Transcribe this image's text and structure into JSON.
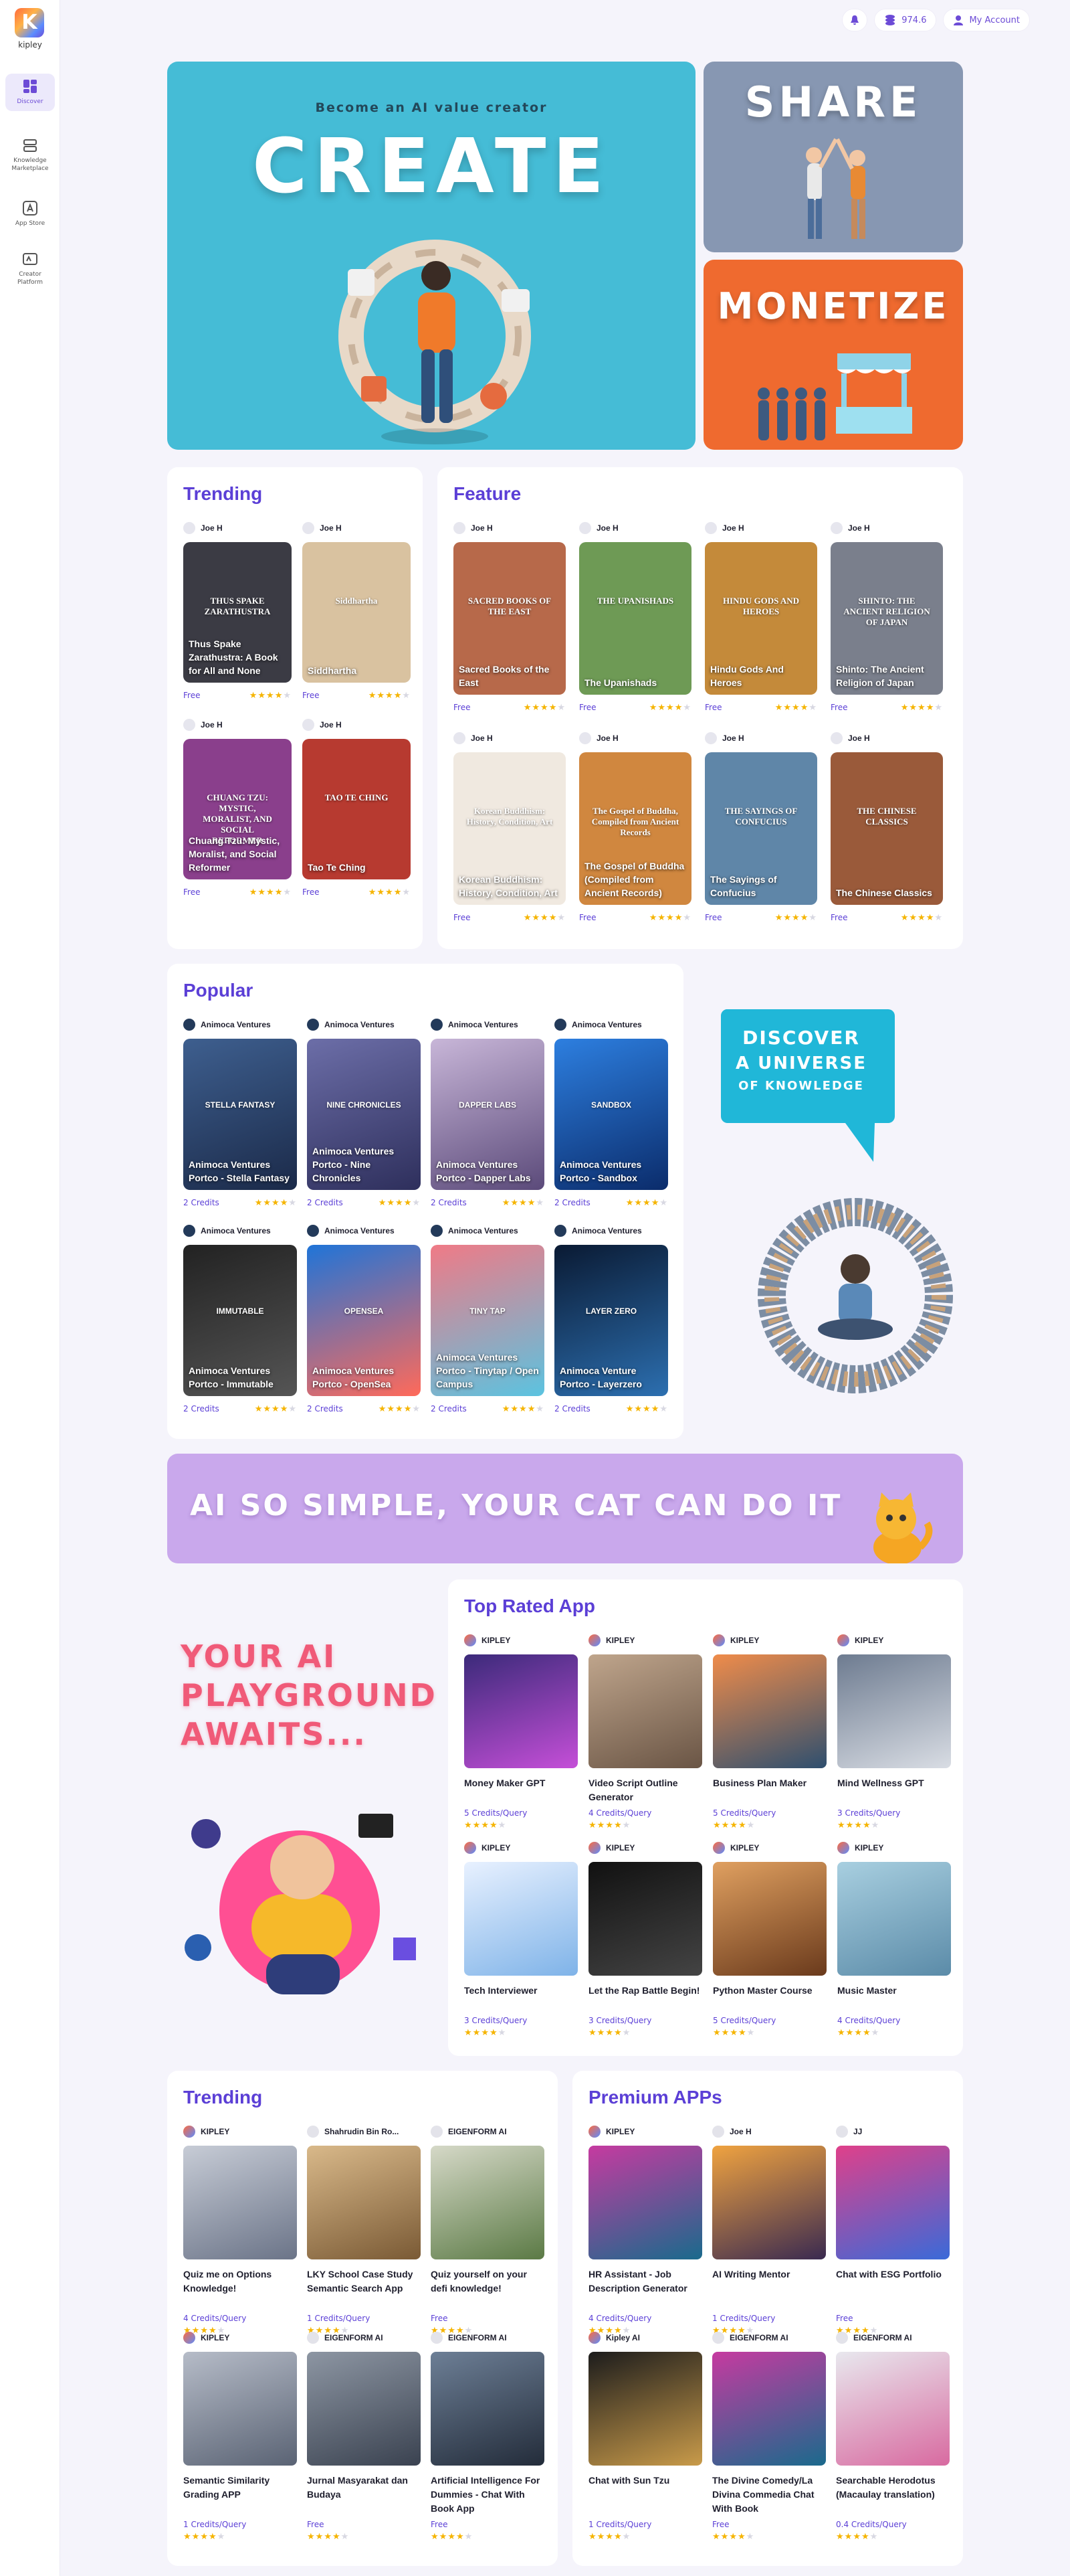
{
  "app": {
    "brand": "kipley",
    "initial": "K"
  },
  "nav": [
    {
      "label": "Discover",
      "icon": "grid-icon"
    },
    {
      "label": "Knowledge Marketplace",
      "icon": "shelf-icon"
    },
    {
      "label": "App Store",
      "icon": "app-store-icon"
    },
    {
      "label": "Creator Platform",
      "icon": "creator-icon"
    }
  ],
  "topbar": {
    "credits": "974.6",
    "account": "My Account"
  },
  "hero": {
    "create_sub": "Become an AI value creator",
    "create": "CREATE",
    "share": "SHARE",
    "monetize": "MONETIZE"
  },
  "trending_books": {
    "title": "Trending",
    "items": [
      {
        "author": "Joe H",
        "cover": "THUS SPAKE ZARATHUSTRA",
        "title": "Thus Spake Zarathustra: A Book for All and None",
        "price": "Free",
        "rating": 4
      },
      {
        "author": "Joe H",
        "cover": "Siddhartha",
        "title": "Siddhartha",
        "price": "Free",
        "rating": 4
      },
      {
        "author": "Joe H",
        "cover": "CHUANG TZU: MYSTIC, MORALIST, AND SOCIAL REFORMER",
        "title": "Chuang Tzu: Mystic, Moralist, and Social Reformer",
        "price": "Free",
        "rating": 4
      },
      {
        "author": "Joe H",
        "cover": "TAO TE CHING",
        "title": "Tao Te Ching",
        "price": "Free",
        "rating": 4
      }
    ]
  },
  "feature_books": {
    "title": "Feature",
    "items": [
      {
        "author": "Joe H",
        "cover": "SACRED BOOKS OF THE EAST",
        "title": "Sacred Books of the East",
        "price": "Free",
        "rating": 4
      },
      {
        "author": "Joe H",
        "cover": "THE UPANISHADS",
        "title": "The Upanishads",
        "price": "Free",
        "rating": 4
      },
      {
        "author": "Joe H",
        "cover": "HINDU GODS AND HEROES",
        "title": "Hindu Gods And Heroes",
        "price": "Free",
        "rating": 4
      },
      {
        "author": "Joe H",
        "cover": "SHINTO: THE ANCIENT RELIGION OF JAPAN",
        "title": "Shinto: The Ancient Religion of Japan",
        "price": "Free",
        "rating": 4
      },
      {
        "author": "Joe H",
        "cover": "Korean Buddhism: History, Condition, Art",
        "title": "Korean Buddhism: History, Condition, Art",
        "price": "Free",
        "rating": 4
      },
      {
        "author": "Joe H",
        "cover": "The Gospel of Buddha, Compiled from Ancient Records",
        "title": "The Gospel of Buddha (Compiled from Ancient Records)",
        "price": "Free",
        "rating": 4
      },
      {
        "author": "Joe H",
        "cover": "THE SAYINGS OF CONFUCIUS",
        "title": "The Sayings of Confucius",
        "price": "Free",
        "rating": 4
      },
      {
        "author": "Joe H",
        "cover": "THE CHINESE CLASSICS",
        "title": "The Chinese Classics",
        "price": "Free",
        "rating": 4
      }
    ]
  },
  "popular": {
    "title": "Popular",
    "items": [
      {
        "author": "Animoca Ventures",
        "cover": "STELLA FANTASY",
        "title": "Animoca Ventures Portco - Stella Fantasy",
        "price": "2 Credits",
        "rating": 4
      },
      {
        "author": "Animoca Ventures",
        "cover": "NINE CHRONICLES",
        "title": "Animoca Ventures Portco - Nine Chronicles",
        "price": "2 Credits",
        "rating": 4
      },
      {
        "author": "Animoca Ventures",
        "cover": "DAPPER LABS",
        "title": "Animoca Ventures Portco - Dapper Labs",
        "price": "2 Credits",
        "rating": 4
      },
      {
        "author": "Animoca Ventures",
        "cover": "SANDBOX",
        "title": "Animoca Ventures Portco - Sandbox",
        "price": "2 Credits",
        "rating": 4
      },
      {
        "author": "Animoca Ventures",
        "cover": "IMMUTABLE",
        "title": "Animoca Ventures Portco - Immutable",
        "price": "2 Credits",
        "rating": 4
      },
      {
        "author": "Animoca Ventures",
        "cover": "OPENSEA",
        "title": "Animoca Ventures Portco - OpenSea",
        "price": "2 Credits",
        "rating": 4
      },
      {
        "author": "Animoca Ventures",
        "cover": "TINY TAP",
        "title": "Animoca Ventures Portco - Tinytap / Open Campus",
        "price": "2 Credits",
        "rating": 4
      },
      {
        "author": "Animoca Ventures",
        "cover": "LAYER ZERO",
        "title": "Animoca Venture Portco - Layerzero",
        "price": "2 Credits",
        "rating": 4
      }
    ]
  },
  "discover_bubble": [
    "DISCOVER",
    "A UNIVERSE",
    "OF KNOWLEDGE"
  ],
  "cat_banner": "AI SO SIMPLE, YOUR CAT CAN DO IT",
  "playground": [
    "YOUR AI",
    "PLAYGROUND",
    "AWAITS..."
  ],
  "top_rated": {
    "title": "Top Rated App",
    "items": [
      {
        "author": "KIPLEY",
        "title": "Money Maker GPT",
        "price": "5 Credits/Query",
        "rating": 4
      },
      {
        "author": "KIPLEY",
        "title": "Video Script Outline Generator",
        "price": "4 Credits/Query",
        "rating": 4
      },
      {
        "author": "KIPLEY",
        "title": "Business Plan Maker",
        "price": "5 Credits/Query",
        "rating": 4
      },
      {
        "author": "KIPLEY",
        "title": "Mind Wellness GPT",
        "price": "3 Credits/Query",
        "rating": 4
      },
      {
        "author": "KIPLEY",
        "title": "Tech Interviewer",
        "price": "3 Credits/Query",
        "rating": 4
      },
      {
        "author": "KIPLEY",
        "title": "Let the Rap Battle Begin!",
        "price": "3 Credits/Query",
        "rating": 4
      },
      {
        "author": "KIPLEY",
        "title": "Python Master Course",
        "price": "5 Credits/Query",
        "rating": 4
      },
      {
        "author": "KIPLEY",
        "title": "Music Master",
        "price": "4 Credits/Query",
        "rating": 4
      }
    ]
  },
  "trending_apps": {
    "title": "Trending",
    "items": [
      {
        "author": "KIPLEY",
        "title": "Quiz me on Options Knowledge!",
        "price": "4 Credits/Query",
        "rating": 4
      },
      {
        "author": "Shahrudin Bin Ro...",
        "title": "LKY School Case Study Semantic Search App",
        "price": "1 Credits/Query",
        "rating": 4
      },
      {
        "author": "EIGENFORM AI",
        "title": "Quiz yourself on your defi knowledge!",
        "price": "Free",
        "rating": 4
      },
      {
        "author": "KIPLEY",
        "title": "Semantic Similarity Grading APP",
        "price": "1 Credits/Query",
        "rating": 4
      },
      {
        "author": "EIGENFORM AI",
        "title": "Jurnal Masyarakat dan Budaya",
        "price": "Free",
        "rating": 4
      },
      {
        "author": "EIGENFORM AI",
        "title": "Artificial Intelligence For Dummies - Chat With Book App",
        "price": "Free",
        "rating": 4
      }
    ]
  },
  "premium_apps": {
    "title": "Premium APPs",
    "items": [
      {
        "author": "KIPLEY",
        "title": "HR Assistant - Job Description Generator",
        "price": "4 Credits/Query",
        "rating": 4
      },
      {
        "author": "Joe H",
        "title": "AI Writing Mentor",
        "price": "1 Credits/Query",
        "rating": 4
      },
      {
        "author": "JJ",
        "title": "Chat with ESG Portfolio",
        "price": "Free",
        "rating": 4
      },
      {
        "author": "Kipley AI",
        "title": "Chat with Sun Tzu",
        "price": "1 Credits/Query",
        "rating": 4
      },
      {
        "author": "EIGENFORM AI",
        "title": "The Divine Comedy/La Divina Commedia Chat With Book",
        "price": "Free",
        "rating": 4
      },
      {
        "author": "EIGENFORM AI",
        "title": "Searchable Herodotus (Macaulay translation)",
        "price": "0.4 Credits/Query",
        "rating": 4
      }
    ]
  }
}
